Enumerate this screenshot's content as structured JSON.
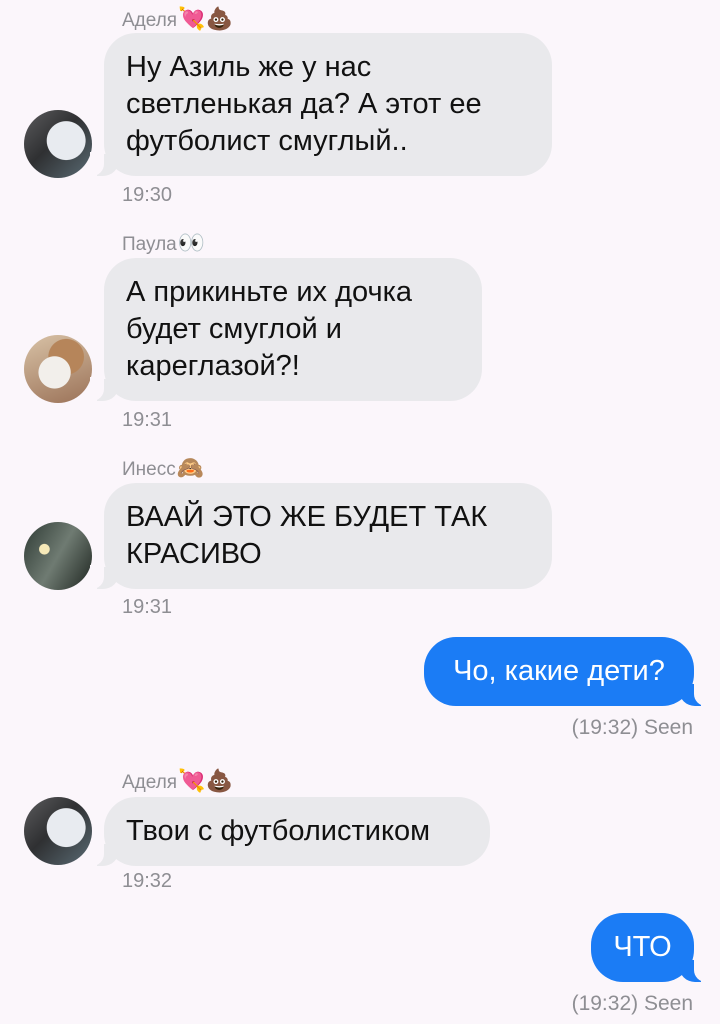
{
  "messages": [
    {
      "sender": "Аделя",
      "sender_emoji": "💘💩",
      "avatar_icon": "avatar-adelya",
      "text": "Ну Азиль же у нас\nсветленькая да? А этот ее\nфутболист смуглый..",
      "time": "19:30"
    },
    {
      "sender": "Паула",
      "sender_emoji": "👀",
      "avatar_icon": "avatar-paula",
      "text": "А прикиньте их дочка\nбудет смуглой и\nкареглазой?!",
      "time": "19:31"
    },
    {
      "sender": "Инесс",
      "sender_emoji": "🙈",
      "avatar_icon": "avatar-iness",
      "text": "ВААЙ ЭТО ЖЕ БУДЕТ ТАК\nКРАСИВО",
      "time": "19:31"
    },
    {
      "outgoing": true,
      "text": "Чо, какие дети?",
      "status": "(19:32) Seen"
    },
    {
      "sender": "Аделя",
      "sender_emoji": "💘💩",
      "avatar_icon": "avatar-adelya",
      "text": "Твои с футболистиком",
      "time": "19:32"
    },
    {
      "outgoing": true,
      "text": "ЧТО",
      "status": "(19:32) Seen"
    }
  ],
  "colors": {
    "background": "#fbf6fb",
    "incoming_bubble": "#e9e9ec",
    "outgoing_bubble": "#1b7cf5",
    "meta_text": "#8e8e93"
  }
}
